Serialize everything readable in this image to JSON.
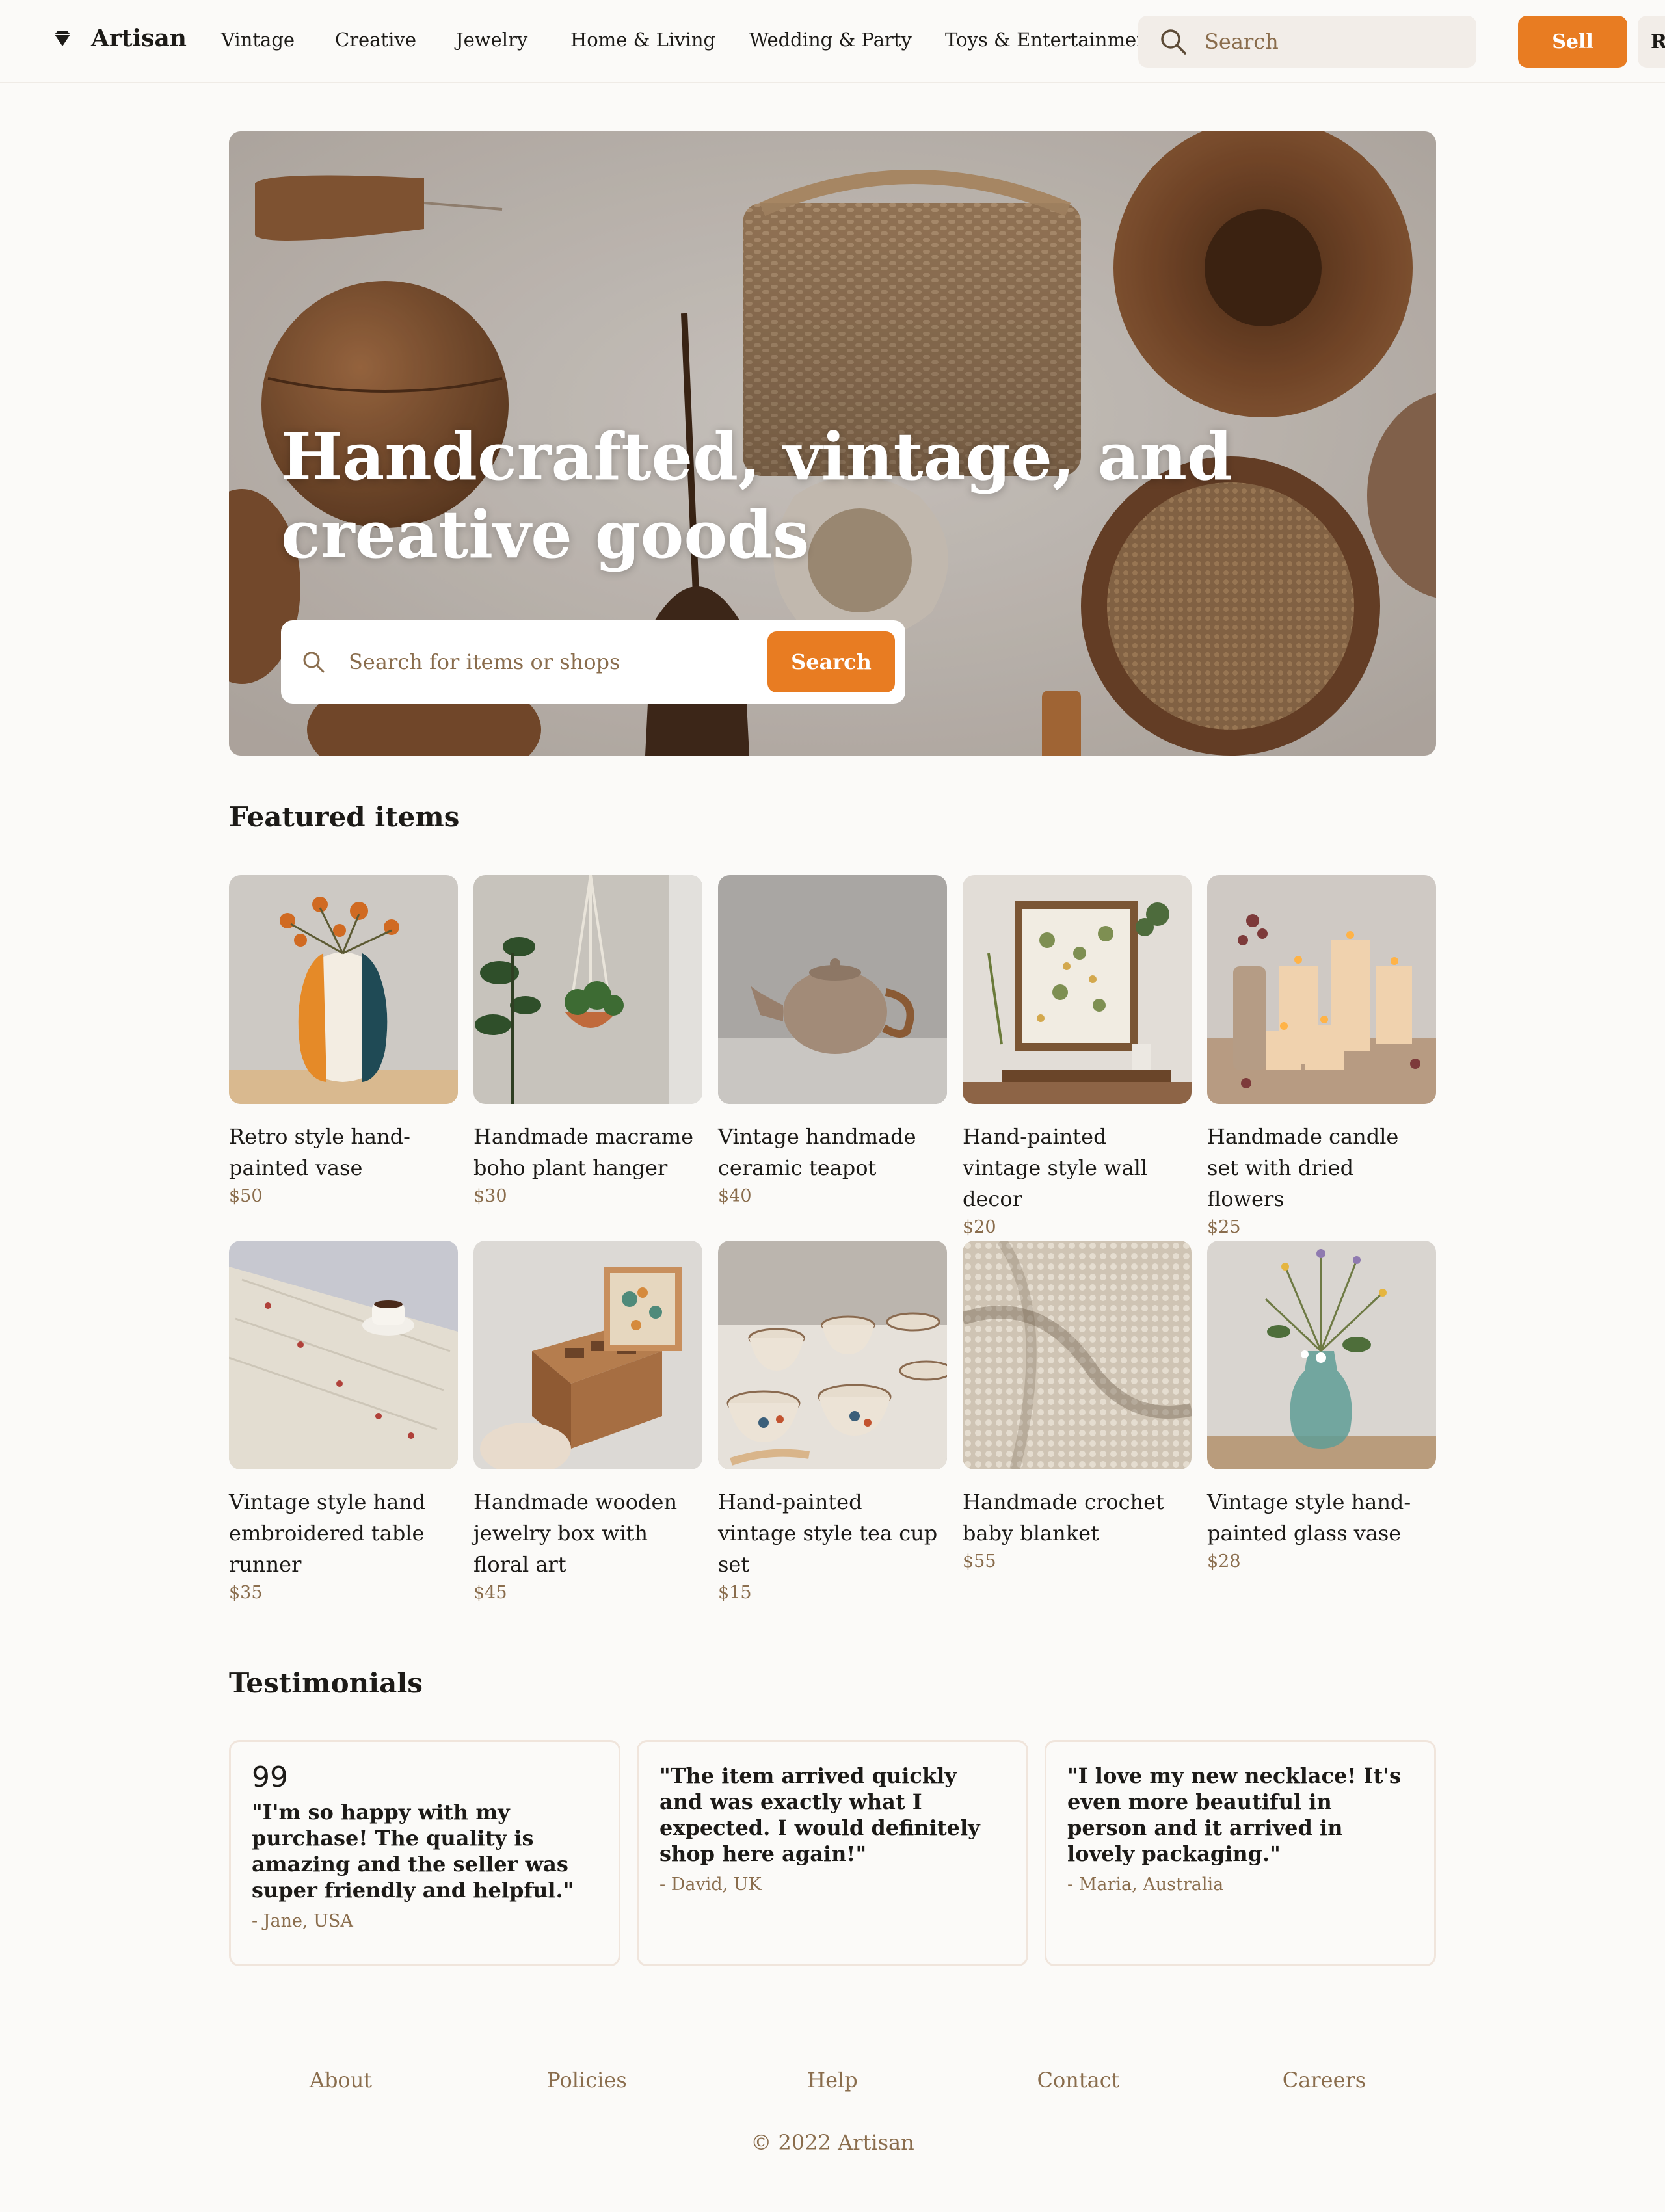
{
  "header": {
    "brand": "Artisan",
    "nav": [
      "Vintage",
      "Creative",
      "Jewelry",
      "Home & Living",
      "Wedding & Party",
      "Toys & Entertainment"
    ],
    "search_placeholder": "Search",
    "sell_label": "Sell",
    "extra_label": "R"
  },
  "hero": {
    "title": "Handcrafted, vintage, and creative goods",
    "search_placeholder": "Search for items or shops",
    "search_button": "Search"
  },
  "featured": {
    "title": "Featured items",
    "items": [
      {
        "name": "Retro style hand-painted vase",
        "price": "$50"
      },
      {
        "name": "Handmade macrame boho plant hanger",
        "price": "$30"
      },
      {
        "name": "Vintage handmade ceramic teapot",
        "price": "$40"
      },
      {
        "name": "Hand-painted vintage style wall decor",
        "price": "$20"
      },
      {
        "name": "Handmade candle set with dried flowers",
        "price": "$25"
      },
      {
        "name": "Vintage style hand embroidered table runner",
        "price": "$35"
      },
      {
        "name": "Handmade wooden jewelry box with floral art",
        "price": "$45"
      },
      {
        "name": "Hand-painted vintage style tea cup set",
        "price": "$15"
      },
      {
        "name": "Handmade crochet baby blanket",
        "price": "$55"
      },
      {
        "name": "Vintage style hand-painted glass vase",
        "price": "$28"
      }
    ]
  },
  "testimonials": {
    "title": "Testimonials",
    "quote_glyph": "99",
    "items": [
      {
        "text": "\"I'm so happy with my purchase! The quality is amazing and the seller was super friendly and helpful.\"",
        "author": "- Jane, USA"
      },
      {
        "text": "\"The item arrived quickly and was exactly what I expected. I would definitely shop here again!\"",
        "author": "- David, UK"
      },
      {
        "text": "\"I love my new necklace! It's even more beautiful in person and it arrived in lovely packaging.\"",
        "author": "- Maria, Australia"
      }
    ]
  },
  "footer": {
    "links": [
      "About",
      "Policies",
      "Help",
      "Contact",
      "Careers"
    ],
    "copyright": "© 2022 Artisan"
  },
  "colors": {
    "accent": "#e87c22",
    "muted_text": "#8a6d4d",
    "background": "#fbfaf8",
    "search_bg": "#f2ede8"
  },
  "icons": {
    "logo": "gem-icon",
    "search": "search-icon",
    "quote": "quote-icon"
  }
}
